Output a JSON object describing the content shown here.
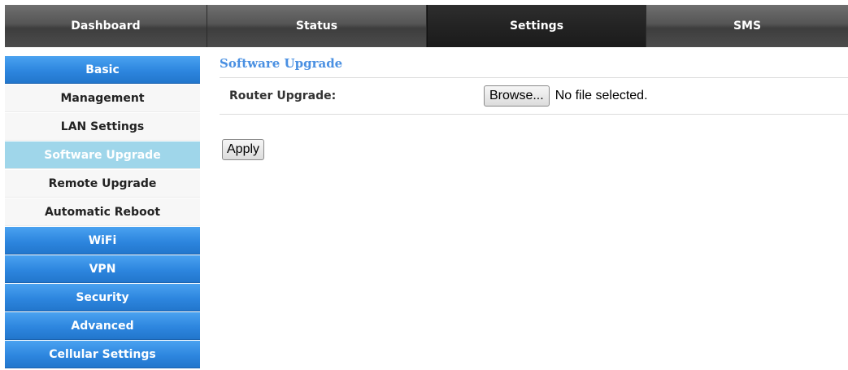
{
  "topnav": {
    "tabs": [
      {
        "label": "Dashboard"
      },
      {
        "label": "Status"
      },
      {
        "label": "Settings",
        "active": true
      },
      {
        "label": "SMS"
      }
    ]
  },
  "sidebar": {
    "items": [
      {
        "label": "Basic",
        "type": "section"
      },
      {
        "label": "Management",
        "type": "sub"
      },
      {
        "label": "LAN Settings",
        "type": "sub"
      },
      {
        "label": "Software Upgrade",
        "type": "sub",
        "selected": true
      },
      {
        "label": "Remote Upgrade",
        "type": "sub"
      },
      {
        "label": "Automatic Reboot",
        "type": "sub"
      },
      {
        "label": "WiFi",
        "type": "section"
      },
      {
        "label": "VPN",
        "type": "section"
      },
      {
        "label": "Security",
        "type": "section"
      },
      {
        "label": "Advanced",
        "type": "section"
      },
      {
        "label": "Cellular Settings",
        "type": "section"
      }
    ]
  },
  "main": {
    "title": "Software Upgrade",
    "router_upgrade_label": "Router Upgrade:",
    "browse_label": "Browse...",
    "file_status": "No file selected.",
    "apply_label": "Apply"
  },
  "colors": {
    "section_blue": "#2d86df",
    "selected_item": "#9fd6ea",
    "title_blue": "#4a90e2",
    "nav_dark": "#3a3a3a"
  }
}
